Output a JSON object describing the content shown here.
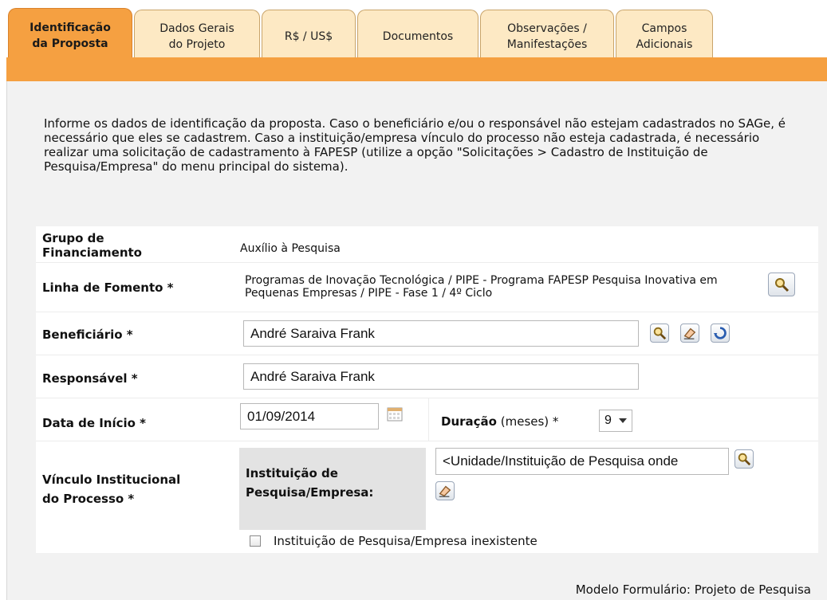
{
  "tabs": [
    {
      "label": "Identificação\nda Proposta",
      "active": true
    },
    {
      "label": "Dados Gerais\ndo Projeto",
      "active": false
    },
    {
      "label": "R$ / US$",
      "active": false
    },
    {
      "label": "Documentos",
      "active": false
    },
    {
      "label": "Observações /\nManifestações",
      "active": false
    },
    {
      "label": "Campos\nAdicionais",
      "active": false
    }
  ],
  "intro": "Informe os dados de identificação da proposta. Caso o beneficiário e/ou o responsável não estejam cadastrados no SAGe, é necessário que eles se cadastrem. Caso a instituição/empresa vínculo do processo não esteja cadastrada, é necessário realizar uma solicitação de cadastramento à FAPESP (utilize a opção \"Solicitações > Cadastro de Instituição de Pesquisa/Empresa\" do menu principal do sistema).",
  "form": {
    "grupo": {
      "label": "Grupo de\nFinanciamento",
      "value": "Auxílio à Pesquisa"
    },
    "linha": {
      "label": "Linha de Fomento *",
      "value": "Programas de Inovação Tecnológica / PIPE - Programa FAPESP Pesquisa Inovativa em Pequenas Empresas / PIPE - Fase 1 / 4º Ciclo"
    },
    "beneficiario": {
      "label": "Beneficiário *",
      "value": "André Saraiva Frank"
    },
    "responsavel": {
      "label": "Responsável *",
      "value": "André Saraiva Frank"
    },
    "data_inicio": {
      "label": "Data de Início *",
      "value": "01/09/2014"
    },
    "duracao": {
      "label_bold": "Duração",
      "label_rest": "(meses) *",
      "value": "9"
    },
    "vinculo": {
      "label": "Vínculo Institucional\ndo Processo *",
      "inst_label": "Instituição de\nPesquisa/Empresa:",
      "inst_value": "<Unidade/Instituição de Pesquisa onde",
      "checkbox_label": "Instituição de Pesquisa/Empresa inexistente",
      "checked": false
    }
  },
  "footer": "Modelo Formulário: Projeto de Pesquisa",
  "colors": {
    "accent": "#f5a041",
    "tab_bg": "#fde9c4",
    "panel_bg": "#f2f2f2"
  }
}
